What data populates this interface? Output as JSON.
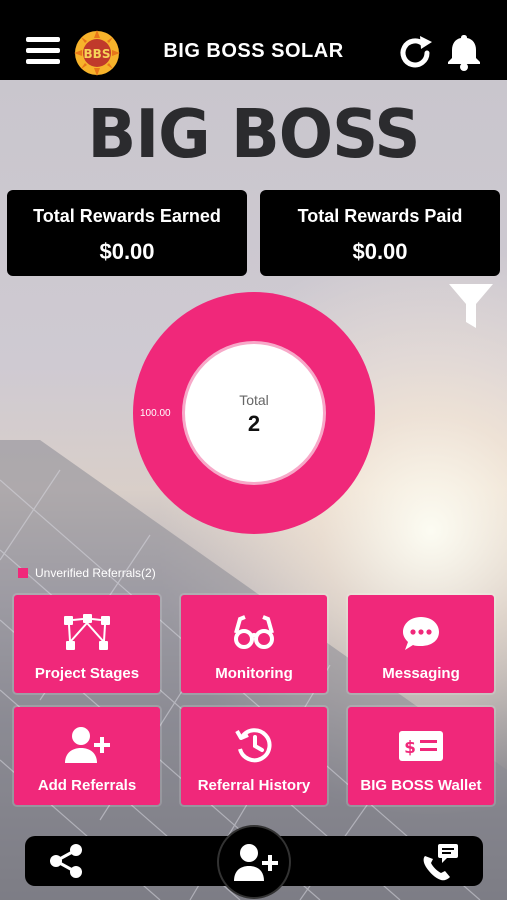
{
  "header": {
    "title": "BIG BOSS SOLAR",
    "logo_text": "BBS"
  },
  "brand": "BIG BOSS",
  "stats": {
    "earned_label": "Total Rewards Earned",
    "earned_value": "$0.00",
    "paid_label": "Total Rewards Paid",
    "paid_value": "$0.00"
  },
  "donut": {
    "total_label": "Total",
    "total_value": "2",
    "slice_label": "100.00",
    "color": "#f0287a"
  },
  "legend": {
    "label": "Unverified Referrals(2)"
  },
  "tiles": [
    {
      "label": "Project Stages",
      "icon": "project-stages-icon"
    },
    {
      "label": "Monitoring",
      "icon": "glasses-icon"
    },
    {
      "label": "Messaging",
      "icon": "chat-icon"
    },
    {
      "label": "Add Referrals",
      "icon": "add-user-icon"
    },
    {
      "label": "Referral History",
      "icon": "history-icon"
    },
    {
      "label": "BIG BOSS Wallet",
      "icon": "wallet-icon"
    }
  ],
  "bottom_nav": {
    "share_icon": "share-icon",
    "fab_icon": "add-user-icon",
    "call_icon": "phone-message-icon"
  },
  "colors": {
    "accent": "#f0287a",
    "bar": "#000000"
  }
}
